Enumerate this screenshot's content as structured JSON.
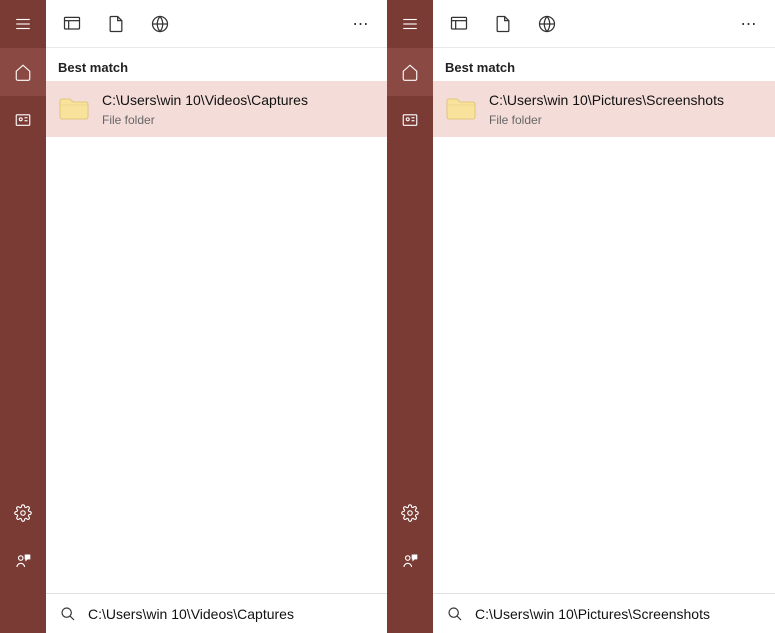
{
  "panels": [
    {
      "best_match_label": "Best match",
      "result": {
        "title": "C:\\Users\\win 10\\Videos\\Captures",
        "subtitle": "File folder"
      },
      "search_value": "C:\\Users\\win 10\\Videos\\Captures"
    },
    {
      "best_match_label": "Best match",
      "result": {
        "title": "C:\\Users\\win 10\\Pictures\\Screenshots",
        "subtitle": "File folder"
      },
      "search_value": "C:\\Users\\win 10\\Pictures\\Screenshots"
    }
  ],
  "icons": {
    "more": "⋯"
  }
}
